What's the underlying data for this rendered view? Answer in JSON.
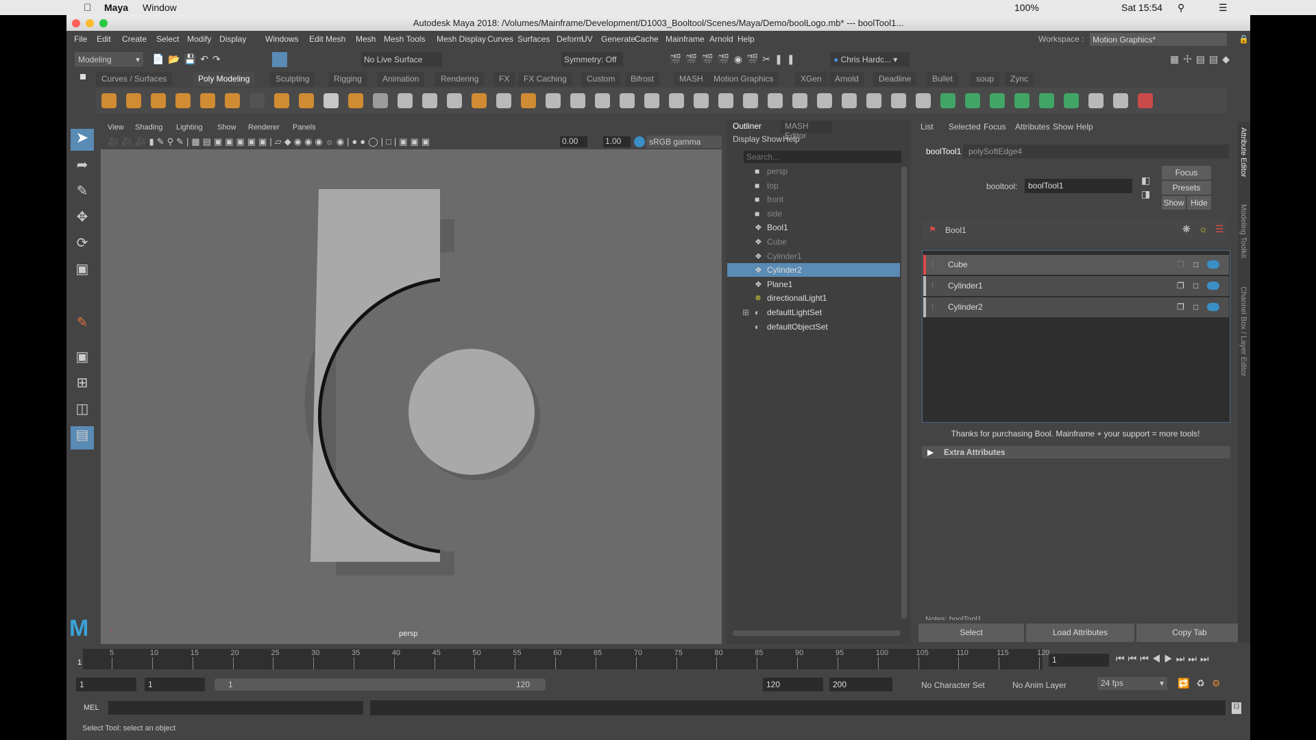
{
  "mac_menubar": {
    "app": "Maya",
    "menus": [
      "Window"
    ],
    "battery": "100%",
    "clock": "Sat 15:54"
  },
  "window": {
    "title": "Autodesk Maya 2018: /Volumes/Mainframe/Development/D1003_Booltool/Scenes/Maya/Demo/boolLogo.mb*  ---  boolTool1..."
  },
  "menus": [
    "File",
    "Edit",
    "Create",
    "Select",
    "Modify",
    "Display",
    "Windows",
    "Edit Mesh",
    "Mesh",
    "Mesh Tools",
    "Mesh Display",
    "Curves",
    "Surfaces",
    "Deform",
    "UV",
    "Generate",
    "Cache",
    "Mainframe",
    "Arnold",
    "Help"
  ],
  "workspace": {
    "label": "Workspace :",
    "value": "Motion Graphics*"
  },
  "status_line": {
    "mode": "Modeling",
    "live_surface": "No Live Surface",
    "symmetry": "Symmetry: Off",
    "user": "Chris Hardc..."
  },
  "shelf_tabs": [
    "Curves / Surfaces",
    "Poly Modeling",
    "Sculpting",
    "Rigging",
    "Animation",
    "Rendering",
    "FX",
    "FX Caching",
    "Custom",
    "Bifrost",
    "MASH",
    "Motion Graphics",
    "XGen",
    "Arnold",
    "Deadline",
    "Bullet",
    "soup",
    "Zync"
  ],
  "shelf_active": "Poly Modeling",
  "viewport": {
    "menus": [
      "View",
      "Shading",
      "Lighting",
      "Show",
      "Renderer",
      "Panels"
    ],
    "exposure": "0.00",
    "gamma": "1.00",
    "color_space": "sRGB gamma",
    "camera_label": "persp",
    "colors": {
      "bg": "#6b6b6b",
      "shape": "#a9a9a9",
      "shadow": "#5e5e5e"
    }
  },
  "outliner": {
    "tabs": [
      "Outliner",
      "MASH Editor"
    ],
    "menus": [
      "Display",
      "Show",
      "Help"
    ],
    "search_placeholder": "Search...",
    "items": [
      {
        "label": "persp",
        "icon": "camera-icon",
        "dim": true
      },
      {
        "label": "top",
        "icon": "camera-icon",
        "dim": true
      },
      {
        "label": "front",
        "icon": "camera-icon",
        "dim": true
      },
      {
        "label": "side",
        "icon": "camera-icon",
        "dim": true
      },
      {
        "label": "Bool1",
        "icon": "transform-icon",
        "dim": false
      },
      {
        "label": "Cube",
        "icon": "transform-icon",
        "dim": true
      },
      {
        "label": "Cylinder1",
        "icon": "transform-icon",
        "dim": true
      },
      {
        "label": "Cylinder2",
        "icon": "transform-icon",
        "dim": true,
        "selected": true
      },
      {
        "label": "Plane1",
        "icon": "transform-icon",
        "dim": false
      },
      {
        "label": "directionalLight1",
        "icon": "light-icon",
        "dim": false
      },
      {
        "label": "defaultLightSet",
        "icon": "set-icon",
        "dim": false,
        "expandable": true
      },
      {
        "label": "defaultObjectSet",
        "icon": "set-icon",
        "dim": false
      }
    ]
  },
  "attribute_editor": {
    "menus": [
      "List",
      "Selected",
      "Focus",
      "Attributes",
      "Show",
      "Help"
    ],
    "tabs": [
      "boolTool1",
      "polySoftEdge4"
    ],
    "node_label": "booltool:",
    "node_value": "boolTool1",
    "focus": "Focus",
    "presets": "Presets",
    "show": "Show",
    "hide": "Hide",
    "bool_header": "Bool1",
    "operands": [
      {
        "label": "Cube",
        "accent": "#e04a4a",
        "active": true
      },
      {
        "label": "Cylinder1",
        "accent": "#bbbbbb"
      },
      {
        "label": "Cylinder2",
        "accent": "#bbbbbb"
      }
    ],
    "thanks": "Thanks for purchasing Bool. Mainframe + your support = more tools!",
    "extra_attributes": "Extra Attributes",
    "notes": "Notes:  boolTool1",
    "buttons": [
      "Select",
      "Load Attributes",
      "Copy Tab"
    ],
    "side_tabs": [
      "Attribute Editor",
      "Modeling Toolkit",
      "Channel Box / Layer Editor"
    ]
  },
  "timeline": {
    "start": 1,
    "end": 120,
    "step": 5,
    "current_frame": "1"
  },
  "range": {
    "start": "1",
    "anim_start": "1",
    "slider_start": "1",
    "slider_end": "120",
    "end": "120",
    "anim_end": "200",
    "character_set": "No Character Set",
    "anim_layer": "No Anim Layer",
    "fps": "24 fps"
  },
  "command_line": {
    "label": "MEL"
  },
  "help_line": "Select Tool: select an object"
}
